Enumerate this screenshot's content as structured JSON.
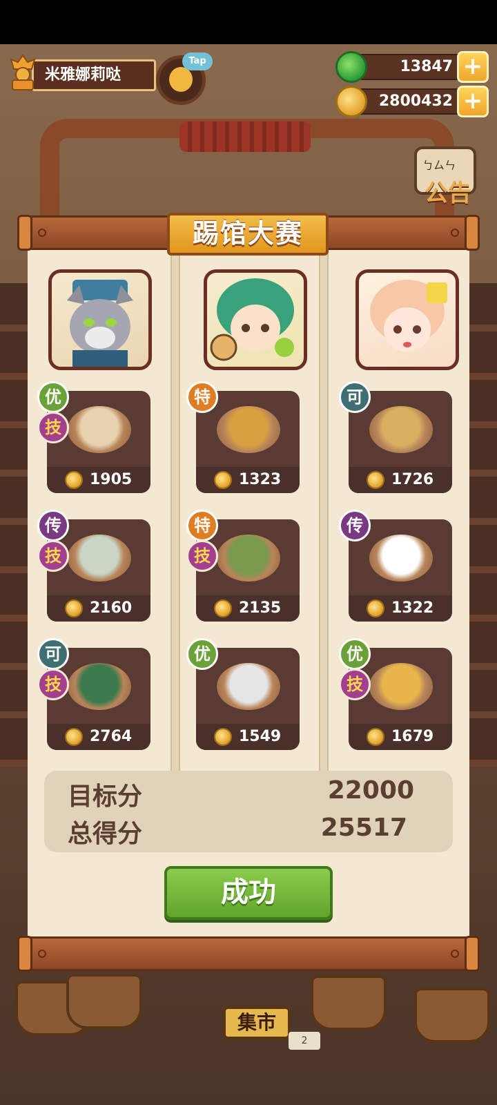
{
  "hud": {
    "player_name": "米雅娜莉哒",
    "tap_label": "Tap",
    "jade_amount": "13847",
    "gold_amount": "2800432",
    "plus": "+"
  },
  "background": {
    "notice_label": "公告",
    "notice_scribble": "ㄅㄙㄣ",
    "market_label": "集市",
    "page_marker": "2"
  },
  "panel": {
    "title": "踢馆大赛",
    "skill_label": "技",
    "columns": [
      {
        "chef": "grey-wolf-chef",
        "dishes": [
          {
            "grade": "优",
            "skill": true,
            "price": "1905"
          },
          {
            "grade": "传",
            "skill": true,
            "price": "2160"
          },
          {
            "grade": "可",
            "skill": true,
            "price": "2764"
          }
        ]
      },
      {
        "chef": "green-hair-chef",
        "dishes": [
          {
            "grade": "特",
            "skill": false,
            "price": "1323"
          },
          {
            "grade": "特",
            "skill": true,
            "price": "2135"
          },
          {
            "grade": "优",
            "skill": false,
            "price": "1549"
          }
        ]
      },
      {
        "chef": "peach-hair-chef",
        "dishes": [
          {
            "grade": "可",
            "skill": false,
            "price": "1726"
          },
          {
            "grade": "传",
            "skill": false,
            "price": "1322"
          },
          {
            "grade": "优",
            "skill": true,
            "price": "1679"
          }
        ]
      }
    ],
    "target_label": "目标分",
    "target_value": "22000",
    "total_label": "总得分",
    "total_value": "25517",
    "result_button": "成功"
  },
  "colors": {
    "grade_you": "#6aa138",
    "grade_te": "#e07d22",
    "grade_ke": "#3f6f72",
    "grade_chuan": "#7a3a82",
    "skill": "#a33f8f",
    "success": "#6aad34"
  }
}
